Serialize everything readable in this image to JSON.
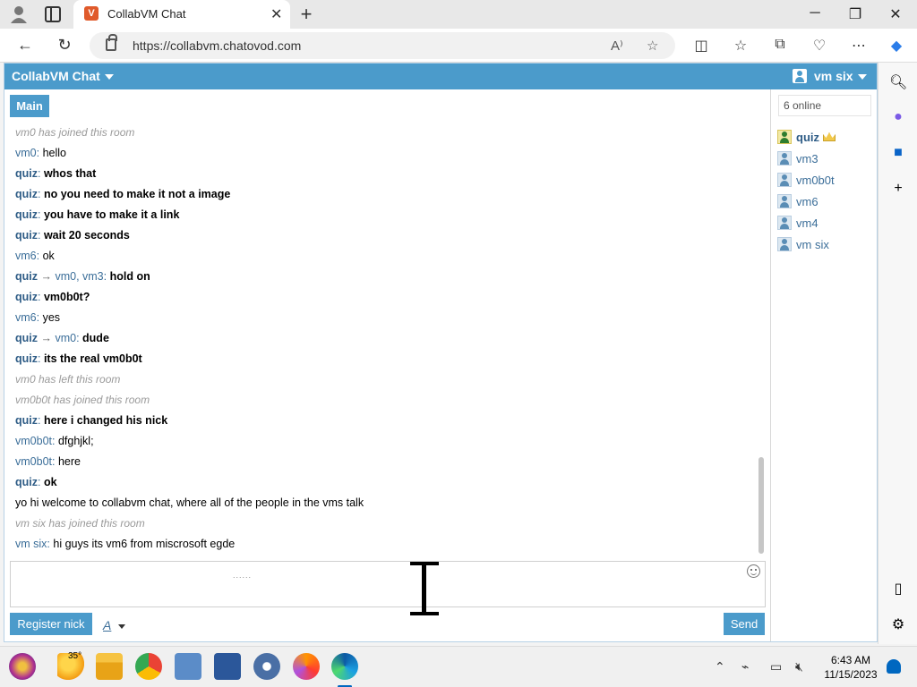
{
  "browser": {
    "tab_title": "CollabVM Chat",
    "favicon_letter": "V",
    "url": "https://collabvm.chatovod.com"
  },
  "app": {
    "title": "CollabVM Chat",
    "current_user": "vm six",
    "room_tab": "Main",
    "online_count": "6 online",
    "accent_color": "#4b9bcb"
  },
  "messages": [
    {
      "type": "system",
      "text": "vm0 has joined this room"
    },
    {
      "type": "msg",
      "nick": "vm0",
      "nick_bold": false,
      "body": "hello",
      "body_bold": false
    },
    {
      "type": "msg",
      "nick": "quiz",
      "nick_bold": true,
      "body": "whos that",
      "body_bold": true
    },
    {
      "type": "msg",
      "nick": "quiz",
      "nick_bold": true,
      "body": "no you need to make it not a image",
      "body_bold": true
    },
    {
      "type": "msg",
      "nick": "quiz",
      "nick_bold": true,
      "body": "you have to make it a link",
      "body_bold": true
    },
    {
      "type": "msg",
      "nick": "quiz",
      "nick_bold": true,
      "body": "wait 20 seconds",
      "body_bold": true
    },
    {
      "type": "msg",
      "nick": "vm6",
      "nick_bold": false,
      "body": "ok",
      "body_bold": false
    },
    {
      "type": "private",
      "nick": "quiz",
      "to": "vm0, vm3",
      "body": "hold on"
    },
    {
      "type": "msg",
      "nick": "quiz",
      "nick_bold": true,
      "body": "vm0b0t?",
      "body_bold": true
    },
    {
      "type": "msg",
      "nick": "vm6",
      "nick_bold": false,
      "body": "yes",
      "body_bold": false
    },
    {
      "type": "private",
      "nick": "quiz",
      "to": "vm0",
      "body": "dude"
    },
    {
      "type": "msg",
      "nick": "quiz",
      "nick_bold": true,
      "body": "its the real vm0b0t",
      "body_bold": true
    },
    {
      "type": "system",
      "text": "vm0 has left this room"
    },
    {
      "type": "system",
      "text": "vm0b0t has joined this room"
    },
    {
      "type": "msg",
      "nick": "quiz",
      "nick_bold": true,
      "body": "here i changed his nick",
      "body_bold": true
    },
    {
      "type": "msg",
      "nick": "vm0b0t",
      "nick_bold": false,
      "body": "dfghjkl;",
      "body_bold": false
    },
    {
      "type": "msg",
      "nick": "vm0b0t",
      "nick_bold": false,
      "body": "here",
      "body_bold": false
    },
    {
      "type": "msg",
      "nick": "quiz",
      "nick_bold": true,
      "body": "ok",
      "body_bold": true
    },
    {
      "type": "plain",
      "text": "yo hi welcome to collabvm chat, where all of the people in the vms talk"
    },
    {
      "type": "system",
      "text": "vm six has joined this room"
    },
    {
      "type": "msg",
      "nick": "vm six",
      "nick_bold": false,
      "body": "hi guys its vm6 from miscrosoft egde",
      "body_bold": false
    }
  ],
  "users": [
    {
      "name": "quiz",
      "admin": true
    },
    {
      "name": "vm3",
      "admin": false
    },
    {
      "name": "vm0b0t",
      "admin": false
    },
    {
      "name": "vm6",
      "admin": false
    },
    {
      "name": "vm4",
      "admin": false
    },
    {
      "name": "vm six",
      "admin": false
    }
  ],
  "composer": {
    "hint": "......",
    "register_label": "Register nick",
    "format_label": "A",
    "send_label": "Send"
  },
  "taskbar": {
    "weather_temp": "35°",
    "time": "6:43 AM",
    "date": "11/15/2023"
  }
}
